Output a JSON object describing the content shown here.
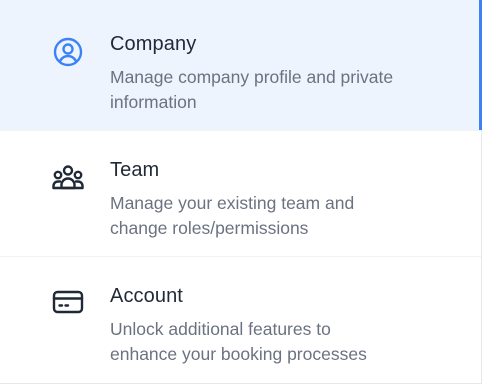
{
  "nav": {
    "items": [
      {
        "title": "Company",
        "description_lines": [
          "Manage company profile and private",
          "information"
        ],
        "icon": "user-circle-icon",
        "active": true
      },
      {
        "title": "Team",
        "description_lines": [
          "Manage your existing team and",
          "change roles/permissions"
        ],
        "icon": "team-icon",
        "active": false
      },
      {
        "title": "Account",
        "description_lines": [
          "Unlock additional features to",
          "enhance your booking processes"
        ],
        "icon": "credit-card-icon",
        "active": false
      }
    ]
  },
  "colors": {
    "accent": "#3b82f6",
    "active_background": "#eef4fe",
    "title_text": "#1f2937",
    "description_text": "#6b7280",
    "inactive_icon": "#1f2937"
  }
}
